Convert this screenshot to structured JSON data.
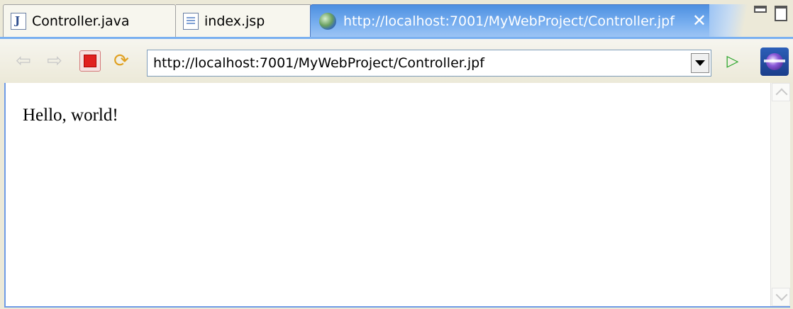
{
  "tabs": [
    {
      "label": "Controller.java",
      "icon": "java-file-icon"
    },
    {
      "label": "index.jsp",
      "icon": "jsp-file-icon"
    },
    {
      "label": "http://localhost:7001/MyWebProject/Controller.jpf",
      "icon": "web-browser-icon",
      "active": true
    }
  ],
  "toolbar": {
    "url_value": "http://localhost:7001/MyWebProject/Controller.jpf",
    "back_icon": "back-arrow-icon",
    "forward_icon": "forward-arrow-icon",
    "stop_icon": "stop-icon",
    "refresh_icon": "refresh-icon",
    "go_icon": "go-icon",
    "eclipse_icon": "eclipse-icon"
  },
  "page": {
    "content": "Hello, world!"
  },
  "colors": {
    "active_tab": "#4d8fe0",
    "background": "#ece9d8",
    "stop_red": "#e02020",
    "go_green": "#28a428"
  }
}
